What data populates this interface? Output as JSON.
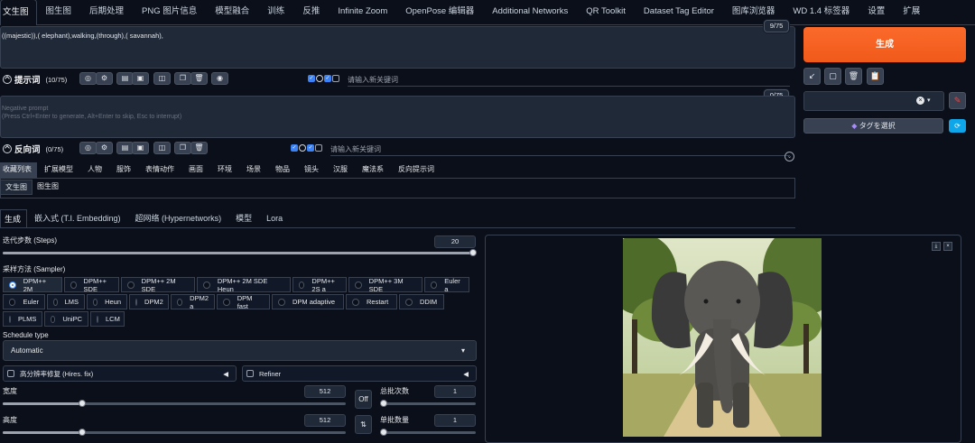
{
  "top_tabs": [
    "文生图",
    "图生图",
    "后期处理",
    "PNG 图片信息",
    "模型融合",
    "训练",
    "反推",
    "Infinite Zoom",
    "OpenPose 编辑器",
    "Additional Networks",
    "QR Toolkit",
    "Dataset Tag Editor",
    "图库浏览器",
    "WD 1.4 标签器",
    "设置",
    "扩展"
  ],
  "prompt": {
    "text": "((majestic)),( elephant),walking,(through),( savannah),",
    "token_count": "9/75",
    "label": "提示词",
    "label_count": "(10/75)",
    "keyword_placeholder": "请输入新关键词"
  },
  "negative": {
    "placeholder_line1": "Negative prompt",
    "placeholder_line2": "(Press Ctrl+Enter to generate, Alt+Enter to skip, Esc to interrupt)",
    "token_count": "0/75",
    "label": "反向词",
    "label_count": "(0/75)",
    "keyword_placeholder": "请输入新关键词"
  },
  "categories": [
    "收藏列表",
    "扩展模型",
    "人物",
    "服饰",
    "表情动作",
    "画面",
    "环境",
    "场景",
    "物品",
    "镜头",
    "汉服",
    "魔法系",
    "反向提示词"
  ],
  "sub_categories": [
    "文生图",
    "图生图"
  ],
  "generate_label": "生成",
  "tag_select_label": "タグを選択",
  "lower_tabs": [
    "生成",
    "嵌入式 (T.I. Embedding)",
    "超网络 (Hypernetworks)",
    "模型",
    "Lora"
  ],
  "steps": {
    "label": "迭代步数 (Steps)",
    "value": "20",
    "fraction": 1.0
  },
  "sampler": {
    "label": "采样方法 (Sampler)",
    "options": [
      "DPM++ 2M",
      "DPM++ SDE",
      "DPM++ 2M SDE",
      "DPM++ 2M SDE Heun",
      "DPM++ 2S a",
      "DPM++ 3M SDE",
      "Euler a",
      "Euler",
      "LMS",
      "Heun",
      "DPM2",
      "DPM2 a",
      "DPM fast",
      "DPM adaptive",
      "Restart",
      "DDIM",
      "PLMS",
      "UniPC",
      "LCM"
    ],
    "selected": "DPM++ 2M"
  },
  "schedule": {
    "label": "Schedule type",
    "value": "Automatic"
  },
  "hires_label": "高分辨率修复 (Hires. fix)",
  "refiner_label": "Refiner",
  "width": {
    "label": "宽度",
    "value": "512"
  },
  "height": {
    "label": "高度",
    "value": "512"
  },
  "batch_count": {
    "label": "总批次数",
    "value": "1"
  },
  "batch_size": {
    "label": "单批数量",
    "value": "1"
  },
  "off_label": "Off",
  "swap_icon": "swap-icon"
}
